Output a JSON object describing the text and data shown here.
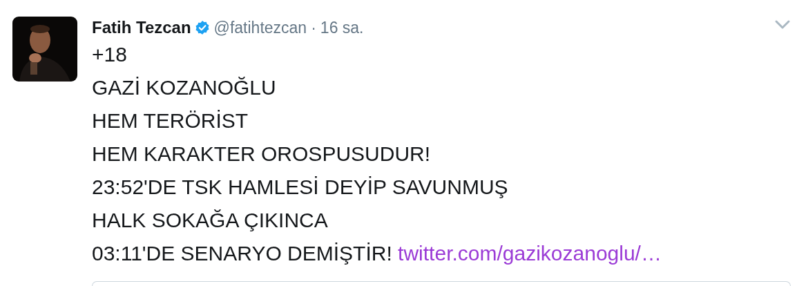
{
  "tweet": {
    "author_name": "Fatih Tezcan",
    "verified": true,
    "handle": "@fatihtezcan",
    "separator": "·",
    "time": "16 sa.",
    "lines": [
      "+18",
      "GAZİ KOZANOĞLU",
      "HEM TERÖRİST",
      "HEM KARAKTER OROSPUSUDUR!",
      "23:52'DE TSK HAMLESİ DEYİP SAVUNMUŞ",
      "HALK SOKAĞA ÇIKINCA",
      "03:11'DE SENARYO DEMİŞTİR!"
    ],
    "link": "twitter.com/gazikozanoglu/…"
  }
}
